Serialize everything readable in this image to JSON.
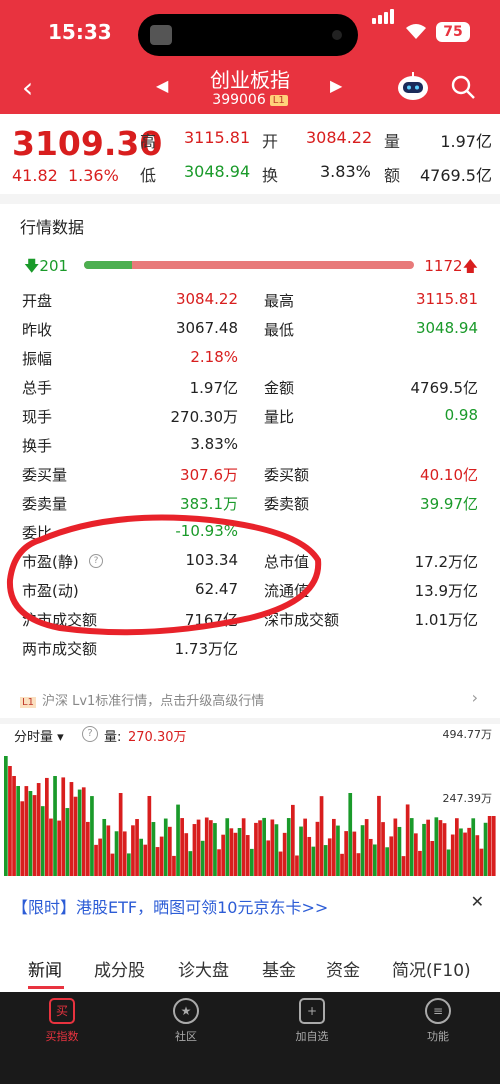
{
  "status": {
    "time": "15:33",
    "battery": "75"
  },
  "nav": {
    "title": "创业板指",
    "code": "399006",
    "level_badge": "L1"
  },
  "quote": {
    "price": "3109.30",
    "change": "41.82",
    "change_pct": "1.36%",
    "high_label": "高",
    "high": "3115.81",
    "low_label": "低",
    "low": "3048.94",
    "open_label": "开",
    "open": "3084.22",
    "turnover_label": "换",
    "turnover": "3.83%",
    "volume_label": "量",
    "volume": "1.97亿",
    "amount_label": "额",
    "amount": "4769.5亿"
  },
  "panel": {
    "title": "行情数据",
    "down_count": "201",
    "up_count": "1172",
    "down_ratio": 0.146,
    "rows": [
      {
        "l1": "开盘",
        "v1": "3084.22",
        "l2": "最高",
        "v2": "3115.81"
      },
      {
        "l1": "昨收",
        "v1": "3067.48",
        "l2": "最低",
        "v2": "3048.94"
      },
      {
        "l1": "振幅",
        "v1": "2.18%",
        "l2": "",
        "v2": ""
      },
      {
        "l1": "总手",
        "v1": "1.97亿",
        "l2": "金额",
        "v2": "4769.5亿"
      },
      {
        "l1": "现手",
        "v1": "270.30万",
        "l2": "量比",
        "v2": "0.98"
      },
      {
        "l1": "换手",
        "v1": "3.83%",
        "l2": "",
        "v2": ""
      },
      {
        "l1": "委买量",
        "v1": "307.6万",
        "l2": "委买额",
        "v2": "40.10亿"
      },
      {
        "l1": "委卖量",
        "v1": "383.1万",
        "l2": "委卖额",
        "v2": "39.97亿"
      },
      {
        "l1": "委比",
        "v1": "-10.93%",
        "l2": "",
        "v2": ""
      },
      {
        "l1": "市盈(静)",
        "v1": "103.34",
        "l2": "总市值",
        "v2": "17.2万亿"
      },
      {
        "l1": "市盈(动)",
        "v1": "62.47",
        "l2": "流通值",
        "v2": "13.9万亿"
      },
      {
        "l1": "沪市成交额",
        "v1": "7167亿",
        "l2": "深市成交额",
        "v2": "1.01万亿"
      },
      {
        "l1": "两市成交额",
        "v1": "1.73万亿",
        "l2": "",
        "v2": ""
      }
    ],
    "tip_badge": "L1",
    "tip": "沪深 Lv1标准行情，点击升级高级行情"
  },
  "chart": {
    "mode": "分时量",
    "vol_label": "量:",
    "vol_value": "270.30万",
    "ymax": "494.77万",
    "ymid": "247.39万"
  },
  "promo": {
    "text": "【限时】港股ETF，晒图可领10元京东卡>>"
  },
  "tabs": [
    "新闻",
    "成分股",
    "诊大盘",
    "基金",
    "资金",
    "简况(F10)"
  ],
  "bottom": [
    {
      "label": "买指数",
      "icon": "买"
    },
    {
      "label": "社区",
      "icon": "★"
    },
    {
      "label": "加自选",
      "icon": "+"
    },
    {
      "label": "功能",
      "icon": "≡"
    }
  ],
  "colors": {
    "up": "#d81e1e",
    "down": "#1a9a2a",
    "header": "#e8333f"
  }
}
